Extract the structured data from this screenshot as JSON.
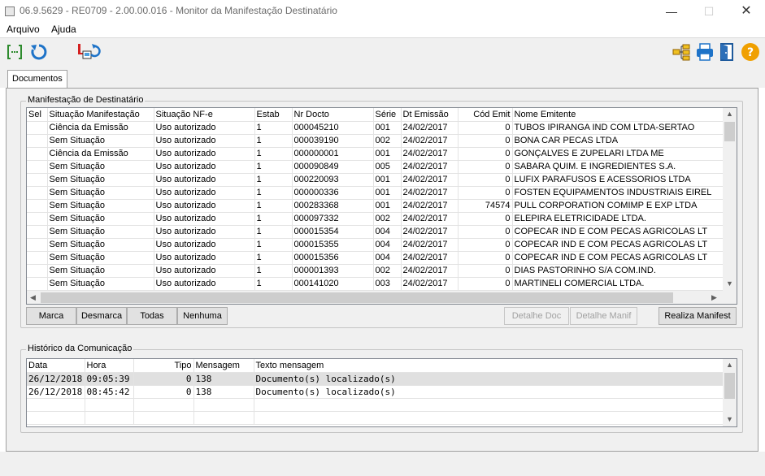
{
  "window": {
    "title": "06.9.5629 - RE0709 - 2.00.00.016 - Monitor da Manifestação Destinatário",
    "minimize": "—",
    "maximize": "☐",
    "close": "✕"
  },
  "menu": {
    "items": [
      "Arquivo",
      "Ajuda"
    ]
  },
  "toolbar": {
    "left_icons": [
      "select-all-icon",
      "refresh-icon",
      "sync-network-icon"
    ],
    "right_icons": [
      "tree-structure-icon",
      "print-icon",
      "exit-door-icon",
      "help-icon"
    ],
    "colors": {
      "green": "#2e8b2e",
      "blue": "#1e73c8",
      "red": "#d42020",
      "help": "#f0a000"
    }
  },
  "tabs": [
    {
      "label": "Documentos",
      "active": true
    }
  ],
  "manifest": {
    "group_label": "Manifestação de Destinatário",
    "columns": [
      "Sel",
      "Situação Manifestação",
      "Situação NF-e",
      "Estab",
      "Nr Docto",
      "Série",
      "Dt Emissão",
      "Cód Emit",
      "Nome Emitente"
    ],
    "rows": [
      [
        "",
        "Ciência da Emissão",
        "Uso autorizado",
        "1",
        "000045210",
        "001",
        "24/02/2017",
        "0",
        "TUBOS IPIRANGA IND COM LTDA-SERTAO"
      ],
      [
        "",
        "Sem Situação",
        "Uso autorizado",
        "1",
        "000039190",
        "002",
        "24/02/2017",
        "0",
        "BONA CAR PECAS LTDA"
      ],
      [
        "",
        "Ciência da Emissão",
        "Uso autorizado",
        "1",
        "000000001",
        "001",
        "24/02/2017",
        "0",
        "GONÇALVES E ZUPELARI LTDA ME"
      ],
      [
        "",
        "Sem Situação",
        "Uso autorizado",
        "1",
        "000090849",
        "005",
        "24/02/2017",
        "0",
        "SABARA QUIM. E INGREDIENTES S.A."
      ],
      [
        "",
        "Sem Situação",
        "Uso autorizado",
        "1",
        "000220093",
        "001",
        "24/02/2017",
        "0",
        "LUFIX PARAFUSOS E ACESSORIOS LTDA"
      ],
      [
        "",
        "Sem Situação",
        "Uso autorizado",
        "1",
        "000000336",
        "001",
        "24/02/2017",
        "0",
        "FOSTEN EQUIPAMENTOS INDUSTRIAIS EIREL"
      ],
      [
        "",
        "Sem Situação",
        "Uso autorizado",
        "1",
        "000283368",
        "001",
        "24/02/2017",
        "74574",
        "PULL CORPORATION COMIMP E EXP LTDA"
      ],
      [
        "",
        "Sem Situação",
        "Uso autorizado",
        "1",
        "000097332",
        "002",
        "24/02/2017",
        "0",
        "ELEPIRA ELETRICIDADE LTDA."
      ],
      [
        "",
        "Sem Situação",
        "Uso autorizado",
        "1",
        "000015354",
        "004",
        "24/02/2017",
        "0",
        "COPECAR IND E COM PECAS AGRICOLAS LT"
      ],
      [
        "",
        "Sem Situação",
        "Uso autorizado",
        "1",
        "000015355",
        "004",
        "24/02/2017",
        "0",
        "COPECAR IND E COM PECAS AGRICOLAS LT"
      ],
      [
        "",
        "Sem Situação",
        "Uso autorizado",
        "1",
        "000015356",
        "004",
        "24/02/2017",
        "0",
        "COPECAR IND E COM PECAS AGRICOLAS LT"
      ],
      [
        "",
        "Sem Situação",
        "Uso autorizado",
        "1",
        "000001393",
        "002",
        "24/02/2017",
        "0",
        "DIAS PASTORINHO S/A COM.IND."
      ],
      [
        "",
        "Sem Situação",
        "Uso autorizado",
        "1",
        "000141020",
        "003",
        "24/02/2017",
        "0",
        "MARTINELI COMERCIAL LTDA."
      ]
    ],
    "buttons": {
      "marca": "Marca",
      "desmarca": "Desmarca",
      "todas": "Todas",
      "nenhuma": "Nenhuma",
      "detalhe_doc": "Detalhe Doc",
      "detalhe_manif": "Detalhe Manif",
      "realiza_manifest": "Realiza Manifest"
    }
  },
  "history": {
    "group_label": "Histórico da Comunicação",
    "columns": [
      "Data",
      "Hora",
      "Tipo",
      "Mensagem",
      "Texto mensagem"
    ],
    "rows": [
      [
        "26/12/2018",
        "09:05:39",
        "0",
        "138",
        "Documento(s) localizado(s)"
      ],
      [
        "26/12/2018",
        "08:45:42",
        "0",
        "138",
        "Documento(s) localizado(s)"
      ]
    ]
  }
}
